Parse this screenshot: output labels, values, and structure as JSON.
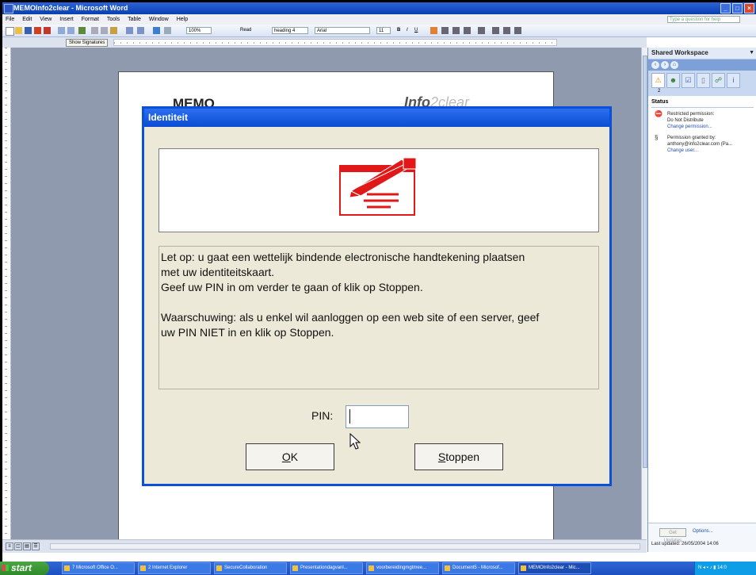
{
  "word": {
    "title": "MEMOInfo2clear - Microsoft Word",
    "menu": [
      "File",
      "Edit",
      "View",
      "Insert",
      "Format",
      "Tools",
      "Table",
      "Window",
      "Help"
    ],
    "help_placeholder": "Type a question for help",
    "zoom": "100%",
    "read_label": "Read",
    "style": "heading 4",
    "font": "Arial",
    "font_size": "11",
    "show_signatures": "Show Signatures",
    "doc_memo": "MEMO",
    "doc_logo_bold": "Info",
    "doc_logo_light": "2clear"
  },
  "pane": {
    "title": "Shared Workspace",
    "tab_count": "2",
    "status_heading": "Status",
    "entries": [
      {
        "line1": "Restricted permission:",
        "line2": "Do Not Distribute",
        "link": "Change permission..."
      },
      {
        "line1": "Permission granted by:",
        "line2": "anthony@info2clear.com (Pa...",
        "link": "Change user..."
      }
    ],
    "get_updates": "Get Updates",
    "options": "Options...",
    "last_updated": "Last updated: 26/05/2004 14:06"
  },
  "dialog": {
    "title": "Identiteit",
    "message_1": "Let op: u gaat een wettelijk bindende electronische handtekening plaatsen\nmet uw identiteitskaart.\nGeef uw PIN in om verder te gaan of klik op Stoppen.",
    "message_2": "Waarschuwing: als u enkel wil aanloggen op een web site of een server, geef\nuw PIN NIET in en klik op Stoppen.",
    "pin_label": "PIN:",
    "pin_value": "",
    "ok_label_u": "O",
    "ok_label_rest": "K",
    "stop_label_u": "S",
    "stop_label_rest": "toppen"
  },
  "taskbar": {
    "start": "start",
    "tasks": [
      "7 Microsoft Office O...",
      "2 Internet Explorer",
      "SecureCollaboration",
      "Presentationdagvanl...",
      "voorbereidingmgtmee...",
      "Document5 - Microsof...",
      "MEMOInfo2clear - Mic..."
    ],
    "clock": "14:0"
  },
  "colors": {
    "dialog_title": "#0b4cd2",
    "dialog_bg": "#ece9d8",
    "signature_red": "#e01818"
  }
}
